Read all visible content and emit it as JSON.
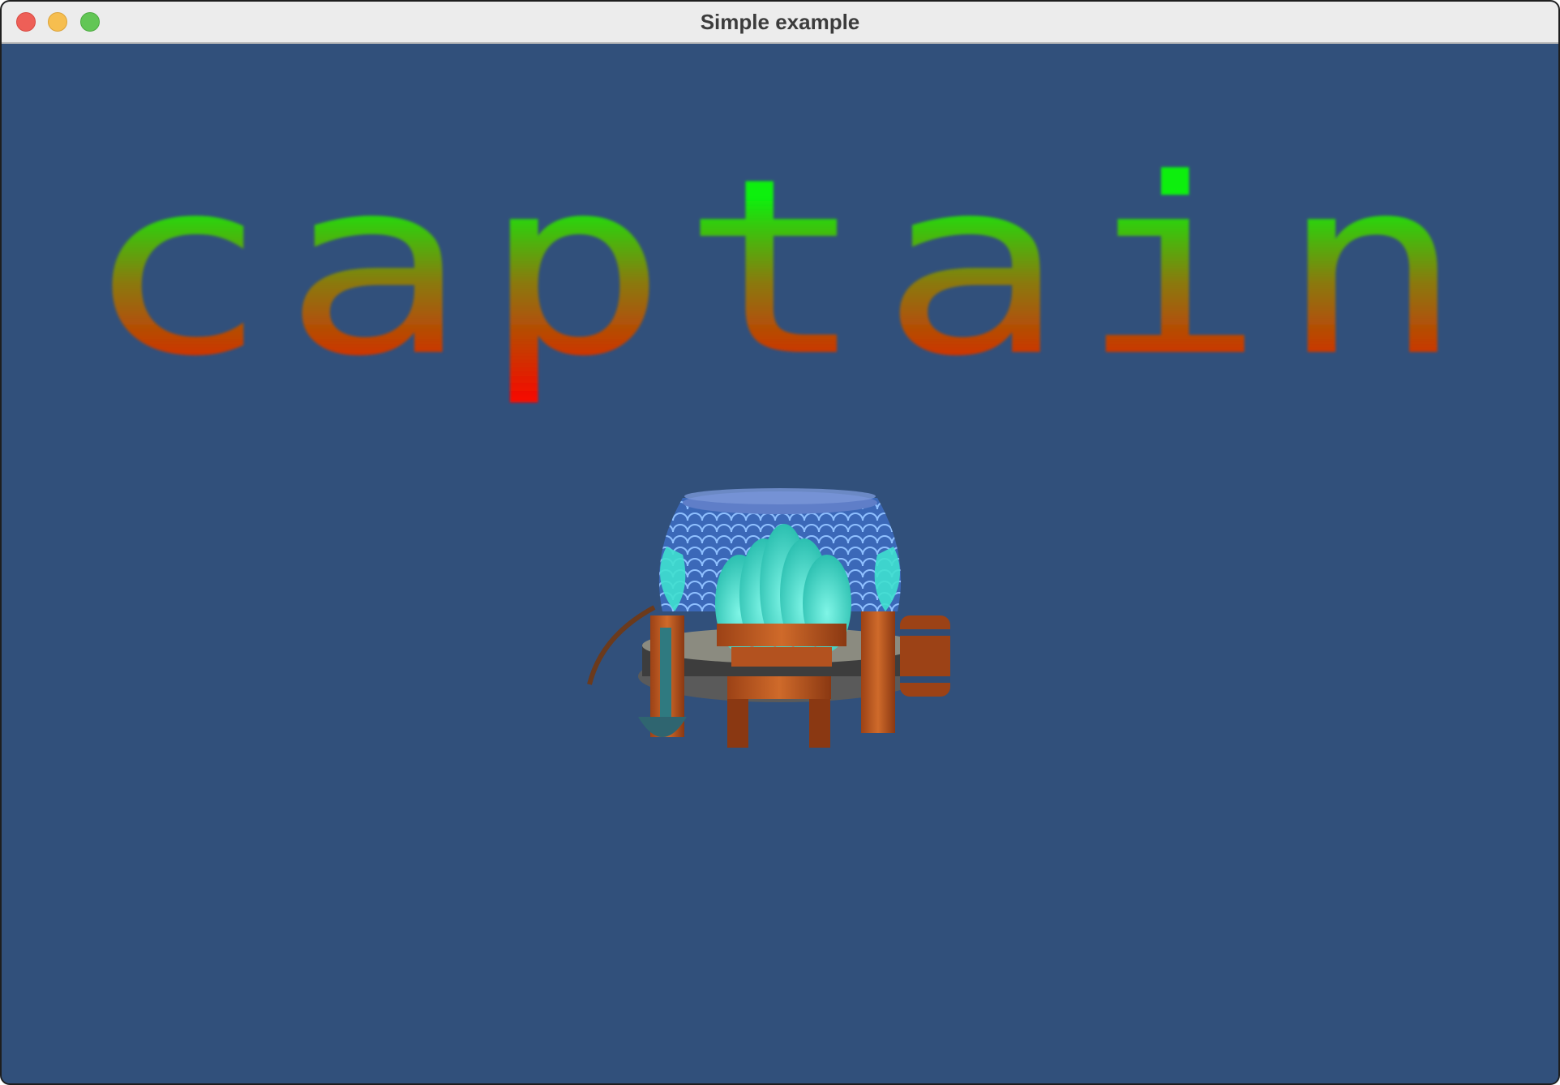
{
  "window": {
    "title": "Simple example",
    "controls": {
      "close": "close-icon",
      "minimize": "minimize-icon",
      "zoom": "zoom-icon"
    }
  },
  "scene": {
    "background_color": "#31507b",
    "logo": {
      "text": "captain",
      "gradient_top": "#00ee11",
      "gradient_bottom": "#ff0000"
    },
    "model": {
      "name": "well-model",
      "colors": {
        "water_dome": "#3fe0cf",
        "scales": "#3f6fc0",
        "wood": "#b8521e",
        "stone": "#6a6a6a"
      }
    }
  }
}
